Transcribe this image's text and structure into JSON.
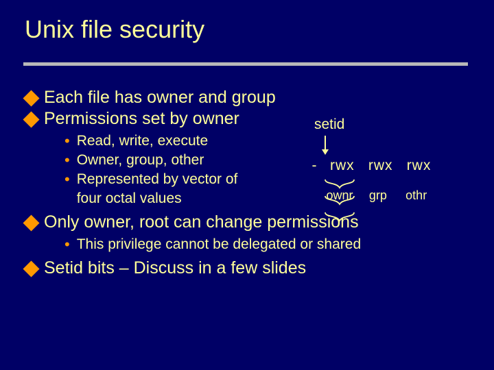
{
  "title": "Unix file security",
  "bullets": {
    "b1": "Each file has owner and group",
    "b2": "Permissions set by owner",
    "b2_sub": {
      "s1": "Read, write, execute",
      "s2": "Owner, group, other",
      "s3": "Represented by vector of",
      "s3b": "four octal values"
    },
    "b3": "Only owner, root can change permissions",
    "b3_sub": {
      "s1": "This privilege cannot be delegated or shared"
    },
    "b4": "Setid bits – Discuss in a few slides"
  },
  "perm": {
    "setid_label": "setid",
    "dash": "-",
    "rwx": "rwx",
    "owner": "ownr",
    "group": "grp",
    "other": "othr"
  },
  "chart_data": {
    "type": "table",
    "title": "Unix permission vector layout",
    "columns": [
      "setid",
      "owner",
      "group",
      "other"
    ],
    "bits": [
      "-",
      "rwx",
      "rwx",
      "rwx"
    ],
    "note": "Represented by vector of four octal values"
  }
}
